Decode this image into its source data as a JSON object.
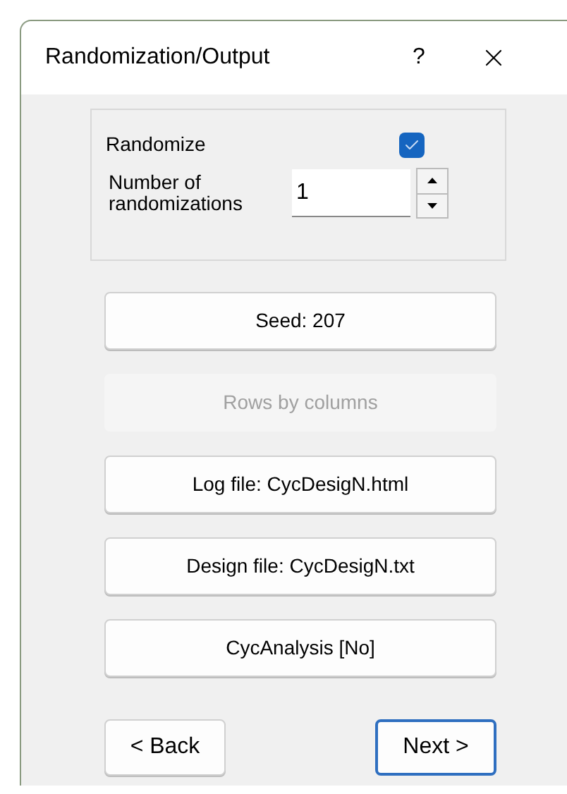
{
  "window": {
    "title": "Randomization/Output",
    "help": "?"
  },
  "randomize": {
    "label": "Randomize",
    "checked": true
  },
  "randomizations": {
    "label": "Number of randomizations",
    "value": "1"
  },
  "buttons": [
    {
      "label": "Seed:  207",
      "disabled": false
    },
    {
      "label": "Rows by columns",
      "disabled": true
    },
    {
      "label": "Log file:  CycDesigN.html",
      "disabled": false
    },
    {
      "label": "Design file:  CycDesigN.txt",
      "disabled": false
    },
    {
      "label": "CycAnalysis [No]",
      "disabled": false
    }
  ],
  "nav": [
    {
      "label": "< Back",
      "default": false
    },
    {
      "label": "Next >",
      "default": true
    }
  ]
}
